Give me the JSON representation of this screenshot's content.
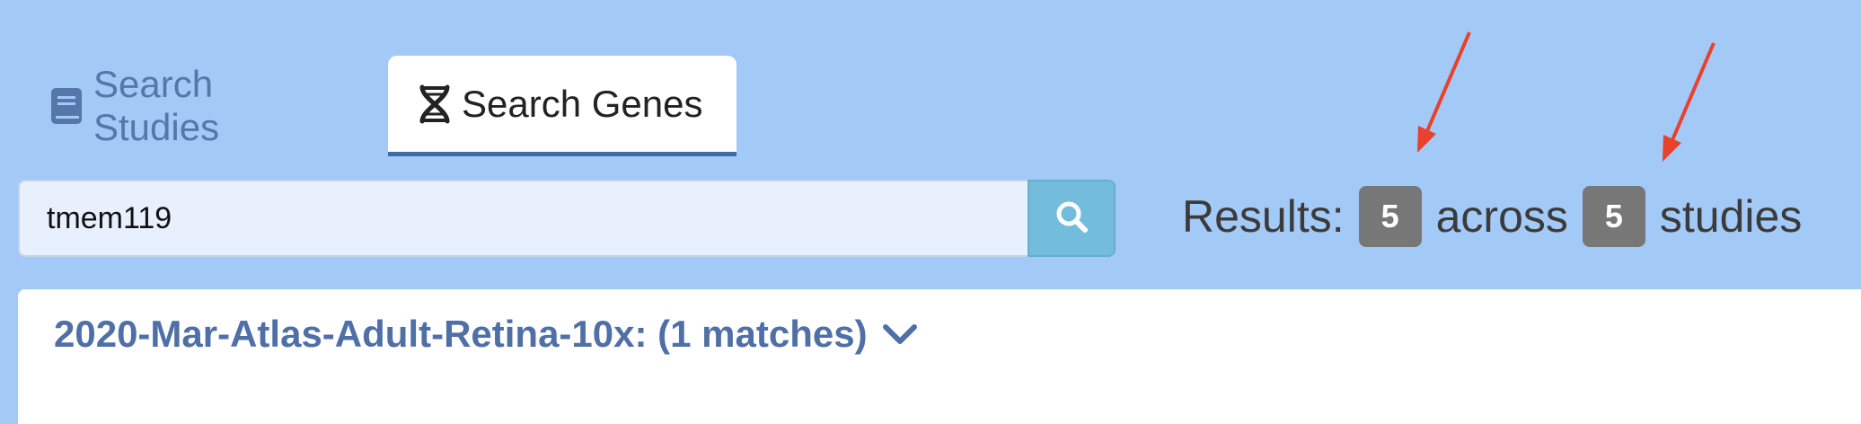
{
  "tabs": [
    {
      "label": "Search Studies",
      "icon": "book-icon",
      "active": false
    },
    {
      "label": "Search Genes",
      "icon": "dna-icon",
      "active": true
    }
  ],
  "search": {
    "value": "tmem119",
    "button_icon": "search-icon"
  },
  "results": {
    "prefix": "Results:",
    "matches_count": "5",
    "middle": "across",
    "studies_count": "5",
    "suffix": "studies"
  },
  "study_card": {
    "title": "2020-Mar-Atlas-Adult-Retina-10x: (1 matches)",
    "toggle_icon": "chevron-down-icon"
  },
  "colors": {
    "page_bg": "#a3c9f7",
    "link_blue": "#5577a9",
    "search_button": "#74bcdc",
    "badge_gray": "#777777",
    "annotation_arrow": "#e8412c"
  }
}
